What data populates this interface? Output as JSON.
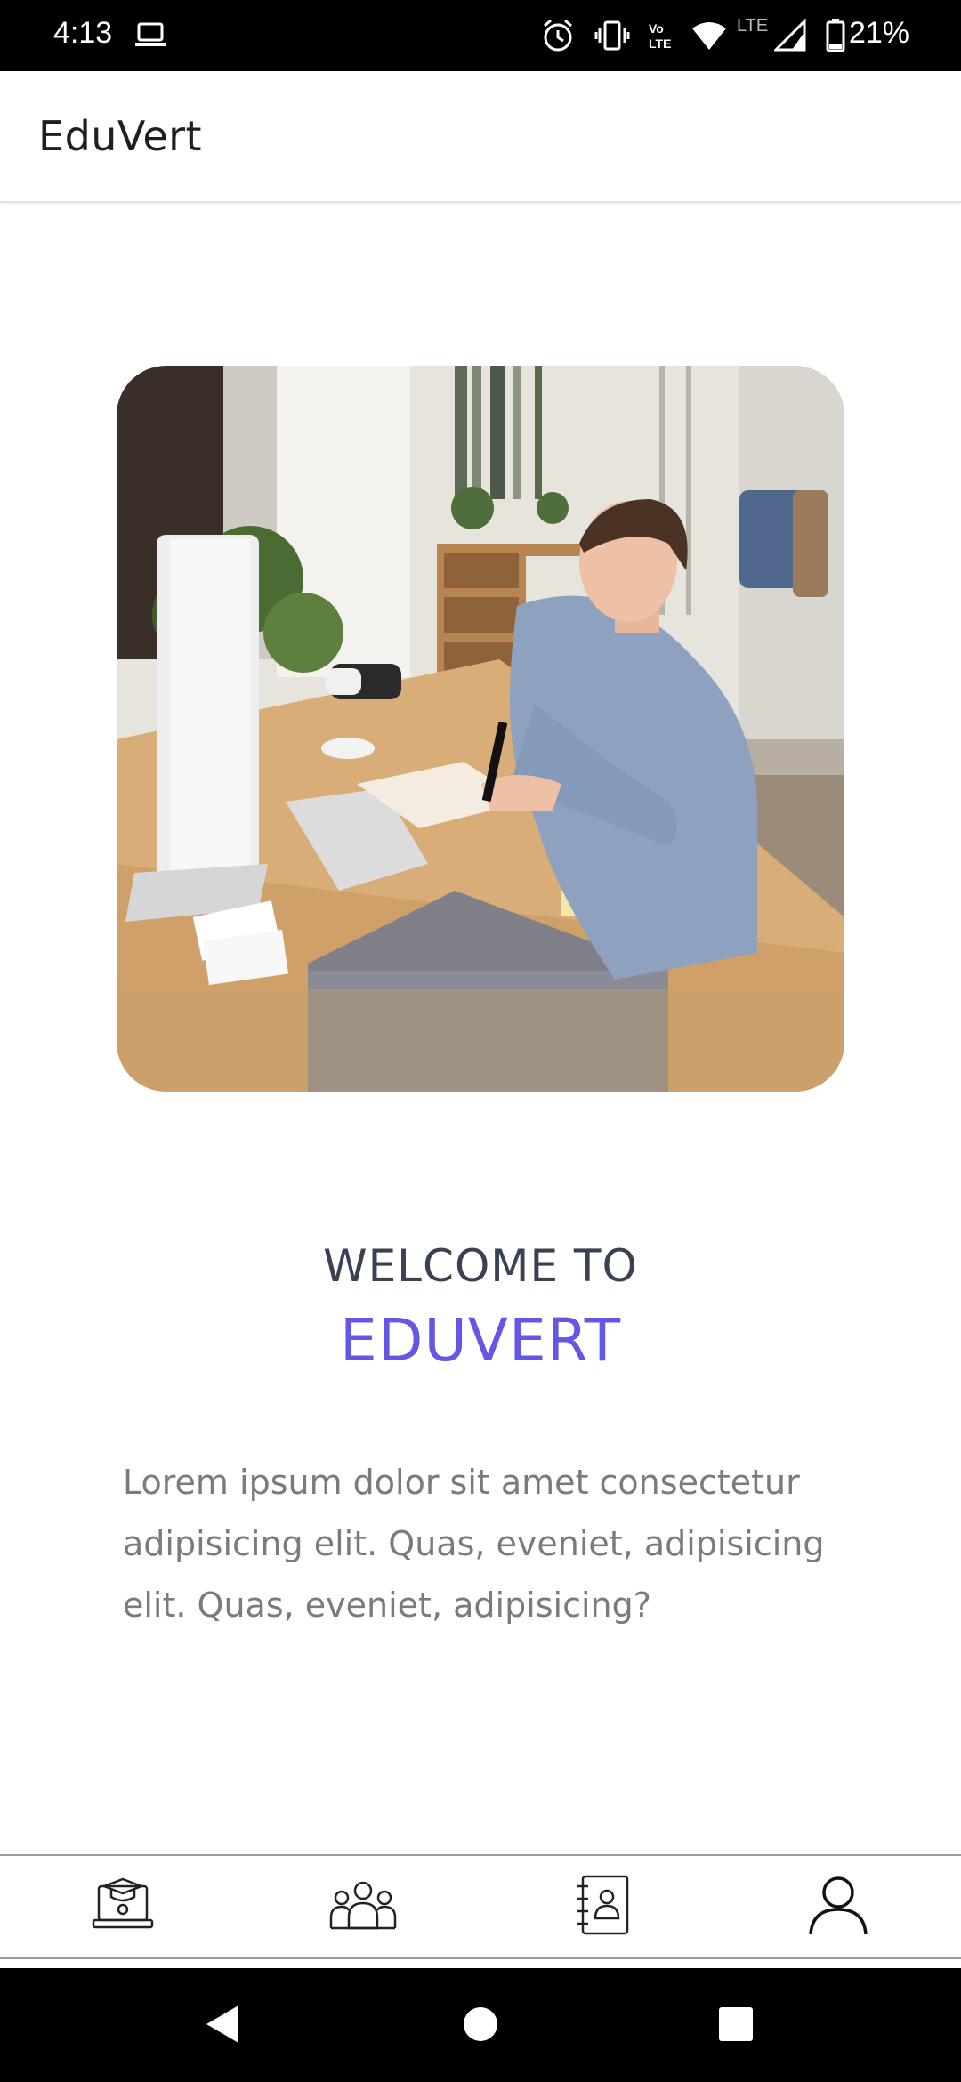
{
  "status_bar": {
    "time": "4:13",
    "network": "LTE",
    "battery": "21%",
    "icons": [
      "laptop-icon",
      "alarm-icon",
      "vibrate-icon",
      "volte-icon",
      "wifi-icon",
      "signal-icon",
      "battery-icon"
    ]
  },
  "app_bar": {
    "title": "EduVert"
  },
  "hero": {
    "image": "student-writing-at-desk-photo"
  },
  "welcome": {
    "line1": "WELCOME TO",
    "brand": "EDUVERT",
    "description": "Lorem ipsum dolor sit amet consectetur adipisicing elit. Quas, eveniet, adipisicing elit. Quas, eveniet, adipisicing?"
  },
  "bottom_nav": {
    "items": [
      {
        "icon": "online-course-icon"
      },
      {
        "icon": "community-icon"
      },
      {
        "icon": "contacts-book-icon"
      },
      {
        "icon": "profile-icon"
      }
    ]
  },
  "system_nav": {
    "buttons": [
      "back-icon",
      "home-icon",
      "recents-icon"
    ]
  },
  "colors": {
    "brand": "#6457e6",
    "heading": "#3a4152",
    "body_text": "#7b7b7b"
  }
}
